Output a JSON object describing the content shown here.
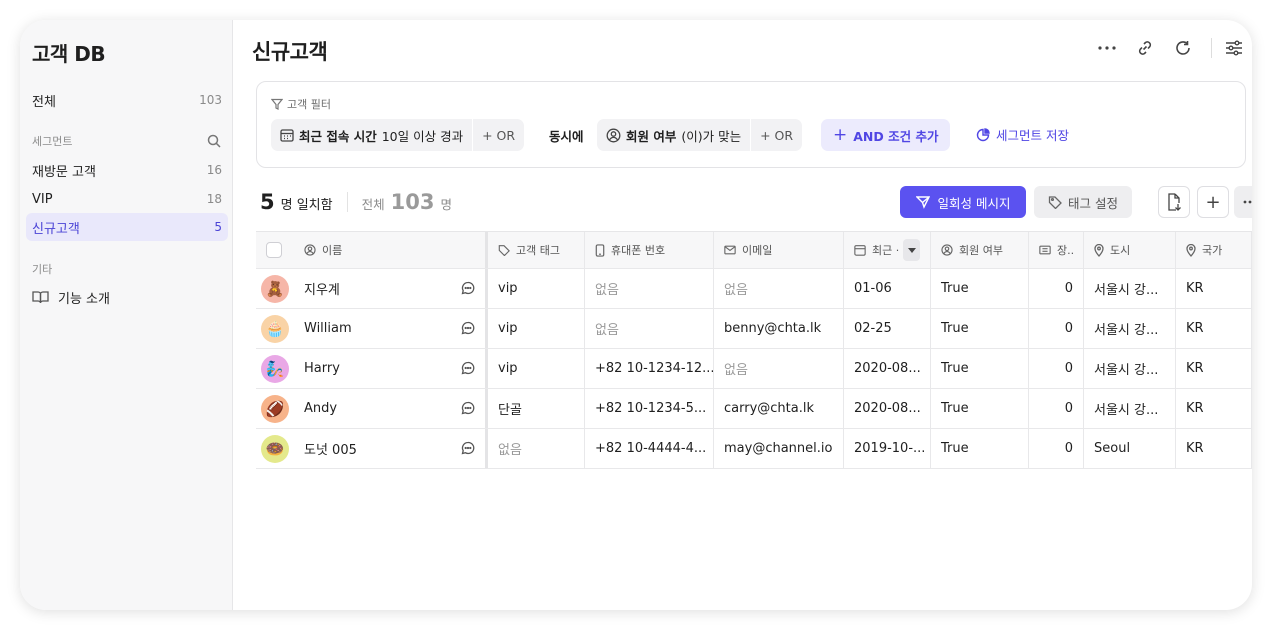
{
  "sidebar": {
    "title": "고객 DB",
    "all": {
      "label": "전체",
      "count": "103"
    },
    "segment_section": "세그먼트",
    "segments": [
      {
        "label": "재방문 고객",
        "count": "16"
      },
      {
        "label": "VIP",
        "count": "18"
      },
      {
        "label": "신규고객",
        "count": "5"
      }
    ],
    "etc_section": "기타",
    "feature_intro": "기능 소개"
  },
  "header": {
    "title": "신규고객"
  },
  "filter": {
    "label": "고객 필터",
    "cond1_key": "최근 접속 시간",
    "cond1_value": "10일 이상 경과",
    "or_label": "+ OR",
    "simul": "동시에",
    "cond2_key": "회원 여부",
    "cond2_value": "(이)가 맞는",
    "and_label": "AND 조건 추가",
    "save_segment": "세그먼트 저장"
  },
  "summary": {
    "match_count": "5",
    "match_unit": "명 일치함",
    "total_label": "전체",
    "total_count": "103",
    "total_unit": "명"
  },
  "actions": {
    "message": "일회성 메시지",
    "tag": "태그 설정"
  },
  "table": {
    "columns": {
      "name": "이름",
      "tag": "고객 태그",
      "phone": "휴대폰 번호",
      "email": "이메일",
      "recent": "최근 ·",
      "member": "회원 여부",
      "points": "장..",
      "city": "도시",
      "country": "국가"
    },
    "rows": [
      {
        "avatar": "🧸",
        "color": "#f6b6a8",
        "name": "지우계",
        "tag": "vip",
        "phone": "없음",
        "email": "없음",
        "recent": "01-06",
        "member": "True",
        "points": "0",
        "city": "서울시 강...",
        "country": "KR"
      },
      {
        "avatar": "🧁",
        "color": "#f9d3a6",
        "name": "William",
        "tag": "vip",
        "phone": "없음",
        "email": "benny@chta.lk",
        "recent": "02-25",
        "member": "True",
        "points": "0",
        "city": "서울시 강...",
        "country": "KR"
      },
      {
        "avatar": "🧞",
        "color": "#e9a8e6",
        "name": "Harry",
        "tag": "vip",
        "phone": "+82 10-1234-12...",
        "email": "없음",
        "recent": "2020-08...",
        "member": "True",
        "points": "0",
        "city": "서울시 강...",
        "country": "KR"
      },
      {
        "avatar": "🏈",
        "color": "#f7b38a",
        "name": "Andy",
        "tag": "단골",
        "phone": "+82 10-1234-5...",
        "email": "carry@chta.lk",
        "recent": "2020-08...",
        "member": "True",
        "points": "0",
        "city": "서울시 강...",
        "country": "KR"
      },
      {
        "avatar": "🍩",
        "color": "#e4e98c",
        "name": "도넛 005",
        "tag": "없음",
        "phone": "+82 10-4444-4...",
        "email": "may@channel.io",
        "recent": "2019-10-...",
        "member": "True",
        "points": "0",
        "city": "Seoul",
        "country": "KR"
      }
    ]
  }
}
